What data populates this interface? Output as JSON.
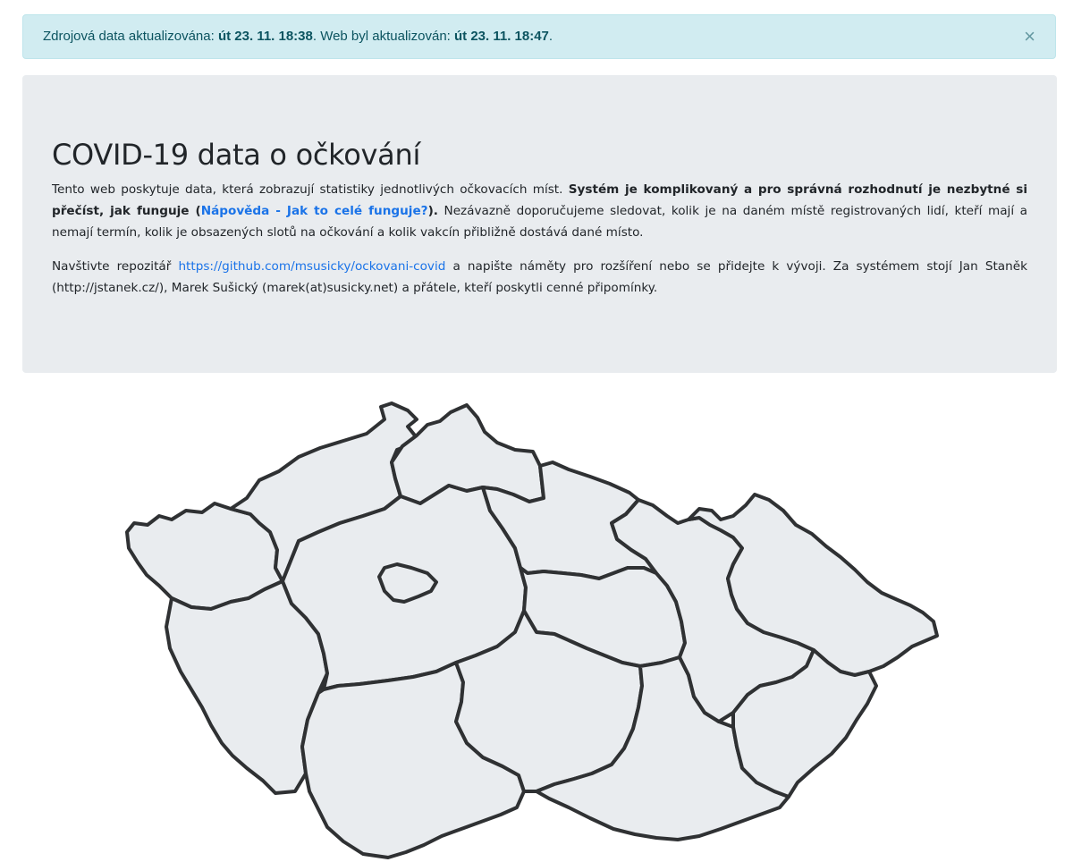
{
  "alert": {
    "prefix": "Zdrojová data aktualizována: ",
    "source_time": "út 23. 11. 18:38",
    "mid": ". Web byl aktualizován: ",
    "web_time": "út 23. 11. 18:47",
    "suffix": ".",
    "close_glyph": "×"
  },
  "intro": {
    "title": "COVID-19 data o očkování",
    "p1_text": "Tento web poskytuje data, která zobrazují statistiky jednotlivých očkovacích míst. ",
    "p1_bold_a": "Systém je komplikovaný a pro správná rozhodnutí je nezbytné si přečíst, jak funguje (",
    "p1_link": "Nápověda - Jak to celé funguje?",
    "p1_bold_b": ").",
    "p1_rest": " Nezávazně doporučujeme sledovat, kolik je na daném místě registrovaných lidí, kteří mají a nemají termín, kolik je obsazených slotů na očkování a kolik vakcín přibližně dostává dané místo.",
    "p2_a": "Navštivte repozitář ",
    "p2_link": "https://github.com/msusicky/ockovani-covid",
    "p2_b": " a napište náměty pro rozšíření nebo se přidejte k vývoji. Za systémem stojí Jan Staněk (http://jstanek.cz/), Marek Sušický (marek(at)susicky.net) a přátele, kteří poskytli cenné připomínky."
  },
  "map": {
    "fill_color": "#e9ecef",
    "stroke_color": "#2f3133",
    "regions": [
      "Karlovarský kraj",
      "Ústecký kraj",
      "Liberecký kraj",
      "Plzeňský kraj",
      "Středočeský kraj",
      "Hlavní město Praha",
      "Královéhradecký kraj",
      "Pardubický kraj",
      "Jihočeský kraj",
      "Kraj Vysočina",
      "Jihomoravský kraj",
      "Olomoucký kraj",
      "Moravskoslezský kraj",
      "Zlínský kraj"
    ]
  }
}
